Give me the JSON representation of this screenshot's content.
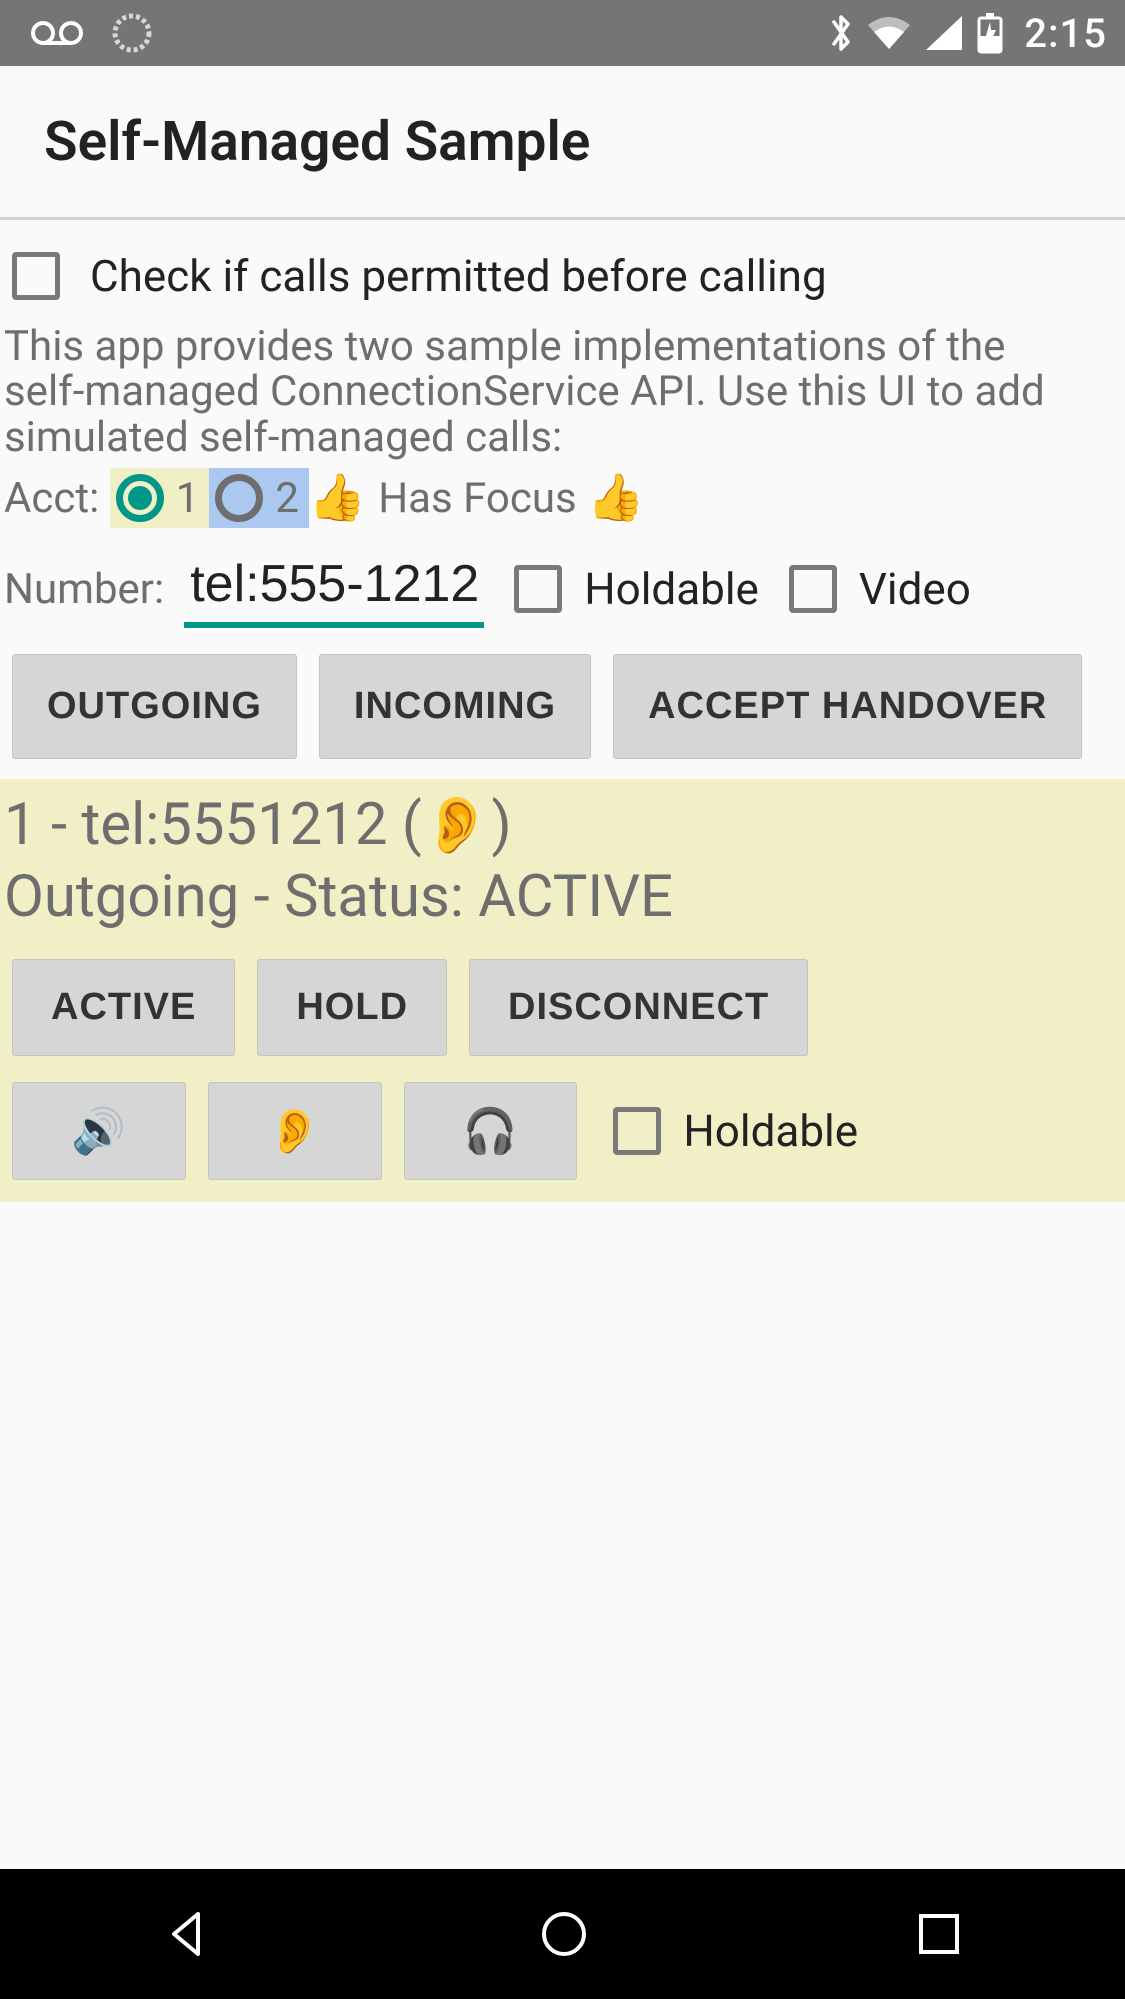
{
  "status": {
    "time": "2:15"
  },
  "header": {
    "title": "Self-Managed Sample"
  },
  "check_permitted": {
    "label": "Check if calls permitted before calling",
    "checked": false
  },
  "description": "This app provides two sample implementations of the self-managed ConnectionService API.  Use this UI to add simulated self-managed calls:",
  "acct": {
    "label": "Acct:",
    "opt1": "1",
    "opt2": "2",
    "focus_text": "Has Focus",
    "thumb": "👍"
  },
  "number_row": {
    "label": "Number:",
    "value": "tel:555-1212",
    "holdable_label": "Holdable",
    "video_label": "Video"
  },
  "sim_buttons": {
    "outgoing": "OUTGOING",
    "incoming": "INCOMING",
    "accept_handover": "ACCEPT HANDOVER"
  },
  "call": {
    "line1_prefix": "1 - tel:5551212 ( ",
    "line1_icon": "👂",
    "line1_suffix": " )",
    "line2": "Outgoing - Status: ACTIVE",
    "btn_active": "ACTIVE",
    "btn_hold": "HOLD",
    "btn_disconnect": "DISCONNECT",
    "btn_speaker": "🔊",
    "btn_ear": "👂",
    "btn_headphones": "🎧",
    "holdable_label": "Holdable"
  }
}
